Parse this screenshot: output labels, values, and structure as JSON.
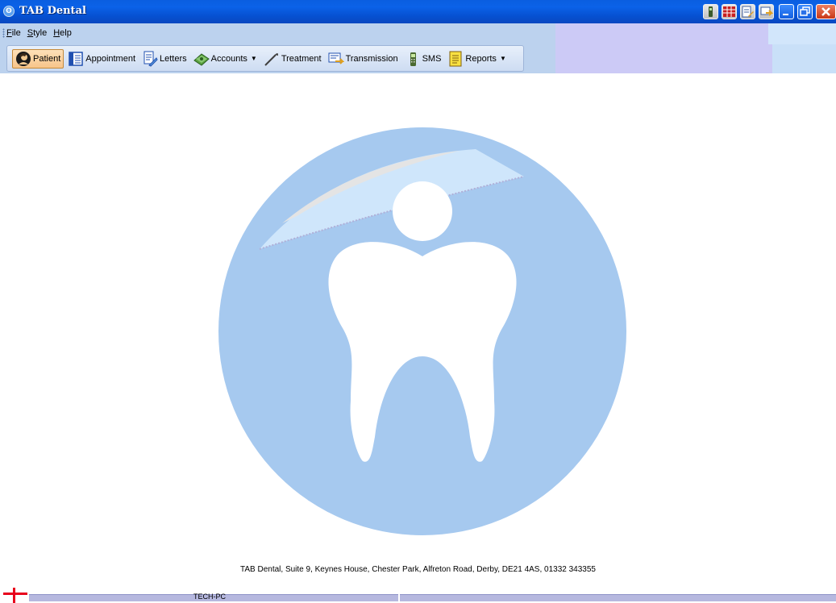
{
  "window": {
    "title": "TAB Dental",
    "app_icon_glyph": "ʘ"
  },
  "menu": {
    "items": [
      "File",
      "Style",
      "Help"
    ]
  },
  "toolbar": {
    "tools": [
      {
        "label": "Patient",
        "icon": "patient-icon",
        "active": true,
        "dropdown": false
      },
      {
        "label": "Appointment",
        "icon": "appointment-book-icon",
        "active": false,
        "dropdown": false
      },
      {
        "label": "Letters",
        "icon": "letters-icon",
        "active": false,
        "dropdown": false
      },
      {
        "label": "Accounts",
        "icon": "accounts-money-icon",
        "active": false,
        "dropdown": true
      },
      {
        "label": "Treatment",
        "icon": "dental-probe-icon",
        "active": false,
        "dropdown": false
      },
      {
        "label": "Transmission",
        "icon": "transmission-icon",
        "active": false,
        "dropdown": false
      },
      {
        "label": "SMS",
        "icon": "mobile-phone-icon",
        "active": false,
        "dropdown": false
      },
      {
        "label": "Reports",
        "icon": "reports-icon",
        "active": false,
        "dropdown": true
      }
    ]
  },
  "footer": {
    "address": "TAB Dental, Suite 9, Keynes House, Chester Park, Alfreton Road, Derby, DE21 4AS, 01332 343355"
  },
  "status": {
    "computer_name": "TECH-PC"
  },
  "colors": {
    "titlebar": "#0b5ee0",
    "logo_circle": "#a6c9ef",
    "active_tool": "#f7c58a",
    "status_flag_red": "#e8001c"
  }
}
